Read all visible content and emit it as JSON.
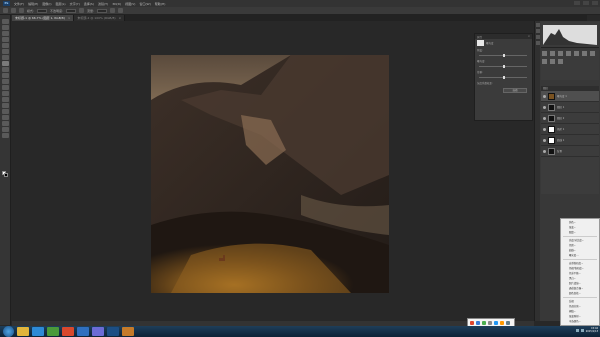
{
  "app": {
    "logo_text": "Ps"
  },
  "menu": {
    "items": [
      "文件(F)",
      "编辑(E)",
      "图像(I)",
      "图层(L)",
      "文字(Y)",
      "选择(S)",
      "滤镜(T)",
      "3D(D)",
      "视图(V)",
      "窗口(W)",
      "帮助(H)"
    ]
  },
  "options": {
    "label_mode": "模式:",
    "label_opacity": "不透明度:",
    "label_flow": "流量:"
  },
  "tabs": [
    {
      "label": "未标题-1 @ 66.7% (图层 1, RGB/8)",
      "close": "×",
      "active": true
    },
    {
      "label": "未标题-2 @ 100% (RGB/8)",
      "close": "×",
      "active": false
    }
  ],
  "dialog": {
    "title": "属性",
    "close": "×",
    "layer_label": "曝光度",
    "row1": "预设:",
    "row2": "曝光度:",
    "row3": "位移:",
    "row4": "灰度系数校正:",
    "button_label": "自动"
  },
  "layers": {
    "header": "图层",
    "items": [
      {
        "name": "曝光度 1",
        "thumb": "img",
        "selected": true
      },
      {
        "name": "图层 1",
        "thumb": "dark",
        "selected": false
      },
      {
        "name": "图层 2",
        "thumb": "dark",
        "selected": false
      },
      {
        "name": "色阶 1",
        "thumb": "white",
        "selected": false
      },
      {
        "name": "曲线 1",
        "thumb": "white",
        "selected": false
      },
      {
        "name": "背景",
        "thumb": "dark",
        "selected": false
      }
    ]
  },
  "context_menu": {
    "items": [
      "纯色...",
      "渐变...",
      "图案...",
      "",
      "亮度/对比度...",
      "色阶...",
      "曲线...",
      "曝光度...",
      "",
      "自然饱和度...",
      "色相/饱和度...",
      "色彩平衡...",
      "黑白...",
      "照片滤镜...",
      "通道混合器...",
      "颜色查找...",
      "",
      "反相",
      "色调分离...",
      "阈值...",
      "渐变映射...",
      "可选颜色..."
    ]
  },
  "taskbar": {
    "clock_time": "15:42",
    "clock_date": "2015/1/13"
  },
  "colors": {
    "accent": "#1c3f66",
    "canvas_bg": "#282828",
    "panel_bg": "#383838"
  }
}
